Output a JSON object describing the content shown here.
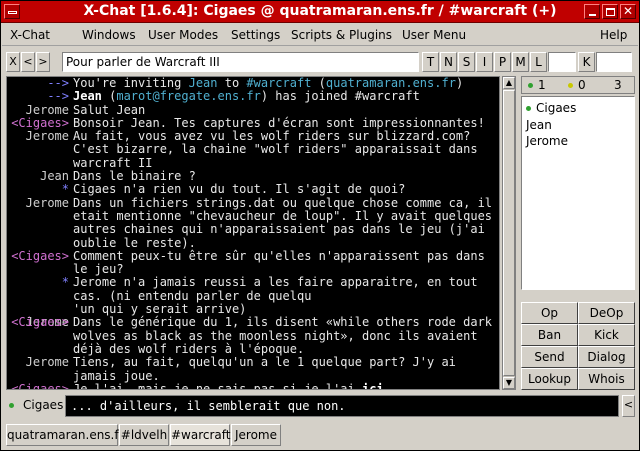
{
  "window": {
    "title": "X-Chat [1.6.4]: Cigaes @ quatramaran.ens.fr / #warcraft (+)"
  },
  "menu": [
    "X-Chat",
    "Windows",
    "User Modes",
    "Settings",
    "Scripts & Plugins",
    "User Menu",
    "Help"
  ],
  "topic": {
    "close_label": "X",
    "left_label": "<",
    "right_label": ">",
    "value": "Pour parler de Warcraft III",
    "modes": [
      "T",
      "N",
      "S",
      "I",
      "P",
      "M",
      "L"
    ],
    "key_label": "K"
  },
  "chat": {
    "lines": [
      {
        "nick": "-->",
        "nick_color": "n-blue",
        "segments": [
          {
            "t": "You're inviting "
          },
          {
            "t": "Jean",
            "c": "cyan"
          },
          {
            "t": " to "
          },
          {
            "t": "#warcraft",
            "c": "cyan"
          },
          {
            "t": " ("
          },
          {
            "t": "quatramaran.ens.fr",
            "c": "cyan"
          },
          {
            "t": ")"
          }
        ]
      },
      {
        "nick": "-->",
        "nick_color": "n-blue",
        "segments": [
          {
            "t": "Jean",
            "c": "b"
          },
          {
            "t": " ("
          },
          {
            "t": "marot@fregate.ens.fr",
            "c": "cyan"
          },
          {
            "t": ") has joined #warcraft"
          }
        ]
      },
      {
        "nick": "Jerome",
        "nick_color": "n-gray",
        "segments": [
          {
            "t": "Salut Jean"
          }
        ]
      },
      {
        "nick": "<Cigaes>",
        "nick_color": "n-pink",
        "segments": [
          {
            "t": "Bonsoir Jean. Tes captures d'écran sont impressionnantes!"
          }
        ]
      },
      {
        "nick": "Jerome",
        "nick_color": "n-gray",
        "segments": [
          {
            "t": "Au fait, vous avez vu les wolf riders sur blizzard.com?\nC'est bizarre, la chaine \"wolf riders\" apparaissait dans warcraft II"
          }
        ]
      },
      {
        "nick": "Jean",
        "nick_color": "n-gray",
        "segments": [
          {
            "t": "Dans le binaire ?"
          }
        ]
      },
      {
        "nick": "*",
        "nick_color": "n-blue",
        "segments": [
          {
            "t": "Cigaes n'a rien vu du tout. Il s'agit de quoi?"
          }
        ]
      },
      {
        "nick": "Jerome",
        "nick_color": "n-gray",
        "segments": [
          {
            "t": "Dans un fichiers strings.dat ou quelque chose comme ca, il etait mentionne \"chevaucheur de loup\". Il y avait quelques autres chaines qui n'apparaissaient pas dans le jeu (j'ai oublie le reste)."
          }
        ]
      },
      {
        "nick": "<Cigaes>",
        "nick_color": "n-pink",
        "segments": [
          {
            "t": "Comment peux-tu être sûr qu'elles n'apparaissent pas dans le jeu?"
          }
        ]
      },
      {
        "nick": "*",
        "nick_color": "n-blue",
        "segments": [
          {
            "t": "Jerome n'a jamais reussi a les faire apparaitre, en tout cas. (ni entendu parler de quelqu\n'un qui y serait arrive)"
          }
        ]
      },
      {
        "nick": "Jerome",
        "nick_color": "n-gray",
        "segments": []
      },
      {
        "nick": "<Cigaes>",
        "nick_color": "n-pink",
        "segments": [
          {
            "t": "Dans le générique du 1, ils disent «while others rode dark wolves as black as the moonless night», donc ils avaient déjà des wolf riders à l'époque."
          }
        ]
      },
      {
        "nick": "Jerome",
        "nick_color": "n-gray",
        "segments": [
          {
            "t": "Tiens, au fait, quelqu'un a le 1 quelque part? J'y ai jamais joue."
          }
        ]
      },
      {
        "nick": "<Cigaes>",
        "nick_color": "n-pink",
        "segments": [
          {
            "t": "Je l'ai, mais je ne sais pas si je l'ai "
          },
          {
            "t": "ici",
            "c": "b"
          },
          {
            "t": "."
          }
        ]
      }
    ]
  },
  "userlist": {
    "counts": [
      "1",
      "0",
      "3"
    ],
    "count_colors": [
      "#30a030",
      "#c8c800",
      ""
    ],
    "users": [
      "Cigaes",
      "Jean",
      "Jerome"
    ],
    "op_dot_color": "#30a030"
  },
  "buttons": [
    "Op",
    "DeOp",
    "Ban",
    "Kick",
    "Send",
    "Dialog",
    "Lookup",
    "Whois"
  ],
  "input": {
    "nick": "Cigaes",
    "value": "... d'ailleurs, il semblerait que non.",
    "right_arrow": "<"
  },
  "tabs": [
    "quatramaran.ens.fr",
    "#ldvelh",
    "#warcraft",
    "Jerome"
  ],
  "active_tab": 2
}
